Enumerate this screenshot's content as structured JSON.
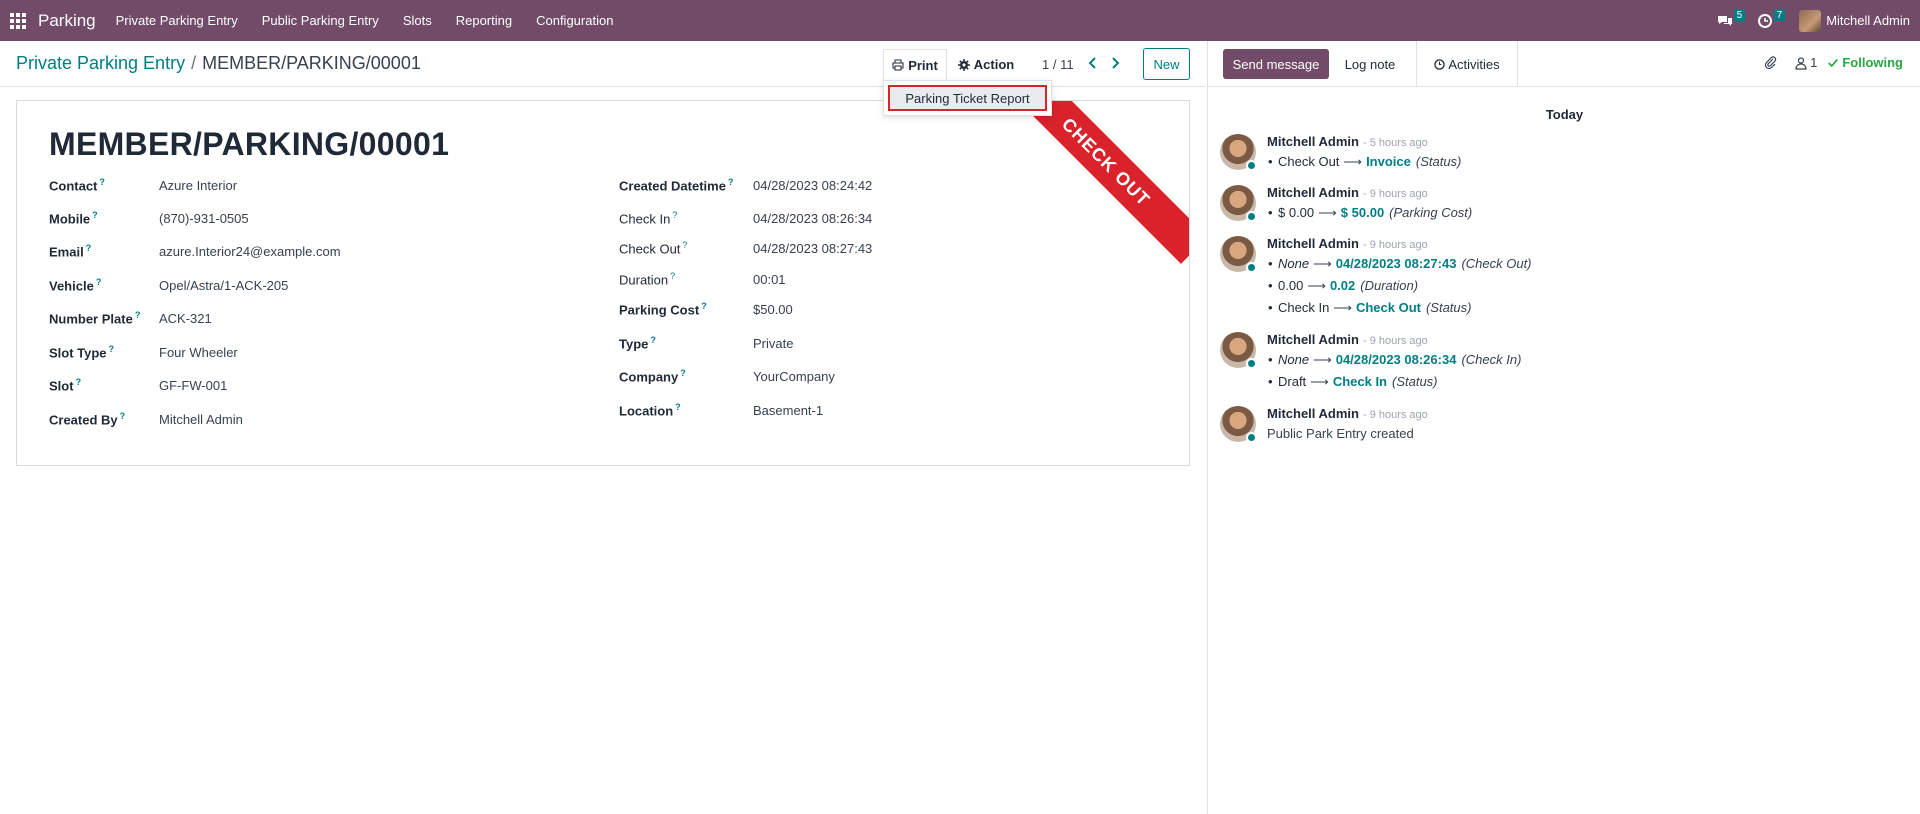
{
  "navbar": {
    "brand": "Parking",
    "menu": [
      "Private Parking Entry",
      "Public Parking Entry",
      "Slots",
      "Reporting",
      "Configuration"
    ],
    "messages_badge": "5",
    "activities_badge": "7",
    "user_name": "Mitchell Admin",
    "color": "#714B67"
  },
  "breadcrumb": {
    "parent": "Private Parking Entry",
    "separator": "/",
    "current": "MEMBER/PARKING/00001"
  },
  "toolbar": {
    "print_label": "Print",
    "action_label": "Action",
    "pager": "1 / 11",
    "new_label": "New"
  },
  "print_menu": {
    "items": [
      "Parking Ticket Report"
    ]
  },
  "record": {
    "title": "MEMBER/PARKING/00001",
    "ribbon": "CHECK OUT",
    "ribbon_color": "#d9222a",
    "help_mark": "?",
    "left_fields": [
      {
        "label": "Contact",
        "value": "Azure Interior"
      },
      {
        "label": "Mobile",
        "value": "(870)-931-0505"
      },
      {
        "label": "Email",
        "value": "azure.Interior24@example.com"
      },
      {
        "label": "Vehicle",
        "value": "Opel/Astra/1-ACK-205"
      },
      {
        "label": "Number Plate",
        "value": "ACK-321"
      },
      {
        "label": "Slot Type",
        "value": "Four Wheeler"
      },
      {
        "label": "Slot",
        "value": "GF-FW-001"
      },
      {
        "label": "Created By",
        "value": "Mitchell Admin"
      }
    ],
    "right_fields": [
      {
        "label": "Created Datetime",
        "value": "04/28/2023 08:24:42"
      },
      {
        "label": "Check In",
        "value": "04/28/2023 08:26:34"
      },
      {
        "label": "Check Out",
        "value": "04/28/2023 08:27:43"
      },
      {
        "label": "Duration",
        "value": "00:01"
      },
      {
        "label": "Parking Cost",
        "value": "$50.00"
      },
      {
        "label": "Type",
        "value": "Private"
      },
      {
        "label": "Company",
        "value": "YourCompany"
      },
      {
        "label": "Location",
        "value": "Basement-1"
      }
    ]
  },
  "chatter": {
    "send_message": "Send message",
    "log_note": "Log note",
    "activities": "Activities",
    "followers_count": "1",
    "following": "Following",
    "date_separator": "Today",
    "messages": [
      {
        "author": "Mitchell Admin",
        "time": "- 5 hours ago",
        "tracking": [
          {
            "old": "Check Out",
            "new": "Invoice",
            "field": "(Status)"
          }
        ]
      },
      {
        "author": "Mitchell Admin",
        "time": "- 9 hours ago",
        "tracking": [
          {
            "old": "$ 0.00",
            "new": "$ 50.00",
            "field": "(Parking Cost)"
          }
        ]
      },
      {
        "author": "Mitchell Admin",
        "time": "- 9 hours ago",
        "tracking": [
          {
            "old": "None",
            "new": "04/28/2023 08:27:43",
            "field": "(Check Out)"
          },
          {
            "old": "0.00",
            "new": "0.02",
            "field": "(Duration)"
          },
          {
            "old": "Check In",
            "new": "Check Out",
            "field": "(Status)"
          }
        ]
      },
      {
        "author": "Mitchell Admin",
        "time": "- 9 hours ago",
        "tracking": [
          {
            "old": "None",
            "new": "04/28/2023 08:26:34",
            "field": "(Check In)"
          },
          {
            "old": "Draft",
            "new": "Check In",
            "field": "(Status)"
          }
        ]
      },
      {
        "author": "Mitchell Admin",
        "time": "- 9 hours ago",
        "body": "Public Park Entry created"
      }
    ]
  }
}
